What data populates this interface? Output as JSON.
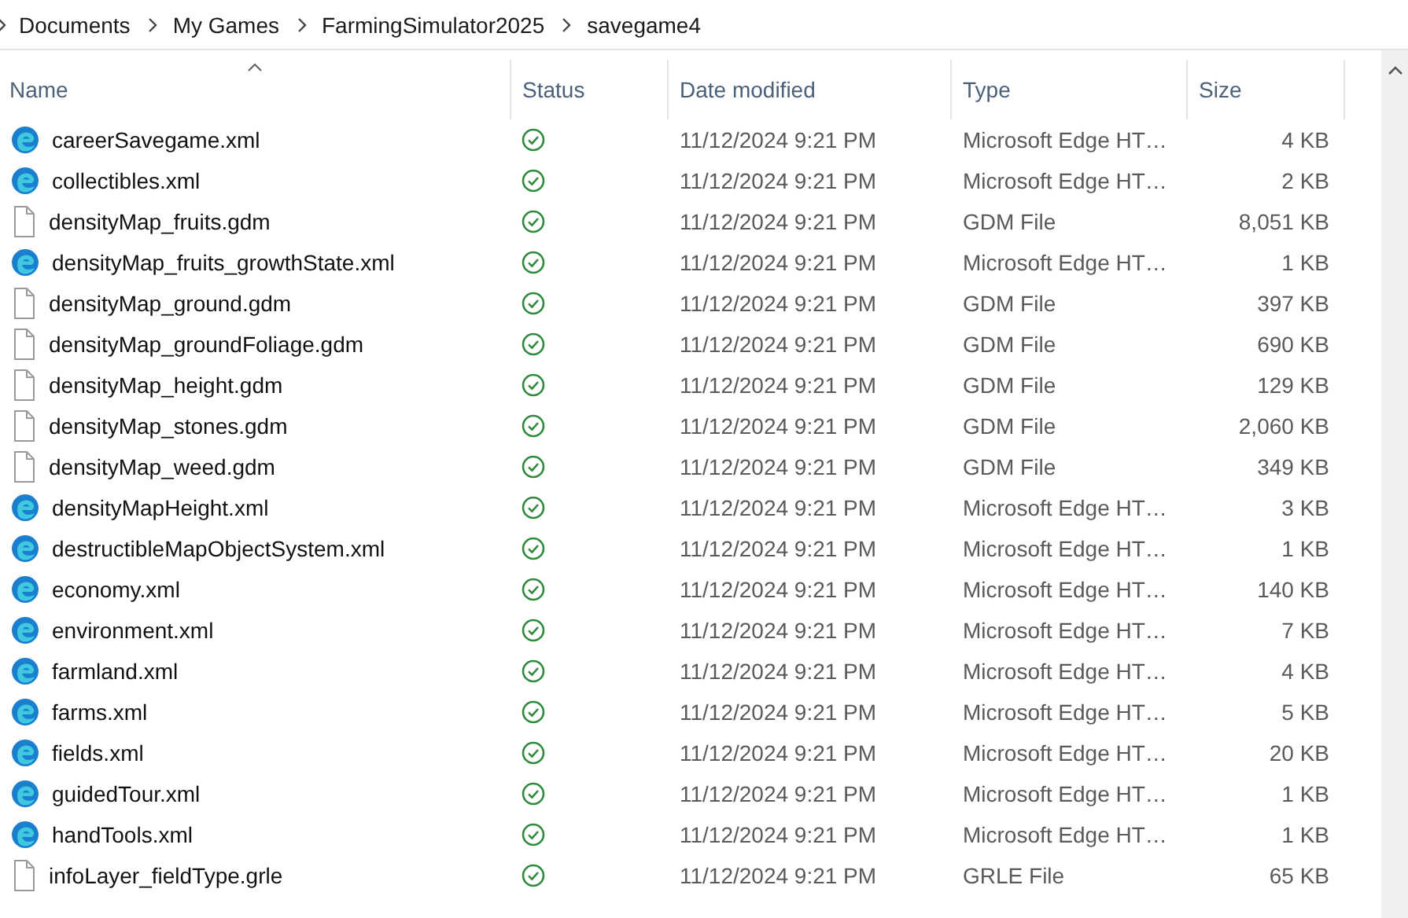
{
  "breadcrumb": [
    "Documents",
    "My Games",
    "FarmingSimulator2025",
    "savegame4"
  ],
  "columns": [
    {
      "label": "Name",
      "sorted": true
    },
    {
      "label": "Status",
      "sorted": false
    },
    {
      "label": "Date modified",
      "sorted": false
    },
    {
      "label": "Type",
      "sorted": false
    },
    {
      "label": "Size",
      "sorted": false
    }
  ],
  "rows": [
    {
      "kind": "edge",
      "name": "careerSavegame.xml",
      "date": "11/12/2024 9:21 PM",
      "type": "Microsoft Edge HT…",
      "size": "4 KB"
    },
    {
      "kind": "edge",
      "name": "collectibles.xml",
      "date": "11/12/2024 9:21 PM",
      "type": "Microsoft Edge HT…",
      "size": "2 KB"
    },
    {
      "kind": "file",
      "name": "densityMap_fruits.gdm",
      "date": "11/12/2024 9:21 PM",
      "type": "GDM File",
      "size": "8,051 KB"
    },
    {
      "kind": "edge",
      "name": "densityMap_fruits_growthState.xml",
      "date": "11/12/2024 9:21 PM",
      "type": "Microsoft Edge HT…",
      "size": "1 KB"
    },
    {
      "kind": "file",
      "name": "densityMap_ground.gdm",
      "date": "11/12/2024 9:21 PM",
      "type": "GDM File",
      "size": "397 KB"
    },
    {
      "kind": "file",
      "name": "densityMap_groundFoliage.gdm",
      "date": "11/12/2024 9:21 PM",
      "type": "GDM File",
      "size": "690 KB"
    },
    {
      "kind": "file",
      "name": "densityMap_height.gdm",
      "date": "11/12/2024 9:21 PM",
      "type": "GDM File",
      "size": "129 KB"
    },
    {
      "kind": "file",
      "name": "densityMap_stones.gdm",
      "date": "11/12/2024 9:21 PM",
      "type": "GDM File",
      "size": "2,060 KB"
    },
    {
      "kind": "file",
      "name": "densityMap_weed.gdm",
      "date": "11/12/2024 9:21 PM",
      "type": "GDM File",
      "size": "349 KB"
    },
    {
      "kind": "edge",
      "name": "densityMapHeight.xml",
      "date": "11/12/2024 9:21 PM",
      "type": "Microsoft Edge HT…",
      "size": "3 KB"
    },
    {
      "kind": "edge",
      "name": "destructibleMapObjectSystem.xml",
      "date": "11/12/2024 9:21 PM",
      "type": "Microsoft Edge HT…",
      "size": "1 KB"
    },
    {
      "kind": "edge",
      "name": "economy.xml",
      "date": "11/12/2024 9:21 PM",
      "type": "Microsoft Edge HT…",
      "size": "140 KB"
    },
    {
      "kind": "edge",
      "name": "environment.xml",
      "date": "11/12/2024 9:21 PM",
      "type": "Microsoft Edge HT…",
      "size": "7 KB"
    },
    {
      "kind": "edge",
      "name": "farmland.xml",
      "date": "11/12/2024 9:21 PM",
      "type": "Microsoft Edge HT…",
      "size": "4 KB"
    },
    {
      "kind": "edge",
      "name": "farms.xml",
      "date": "11/12/2024 9:21 PM",
      "type": "Microsoft Edge HT…",
      "size": "5 KB"
    },
    {
      "kind": "edge",
      "name": "fields.xml",
      "date": "11/12/2024 9:21 PM",
      "type": "Microsoft Edge HT…",
      "size": "20 KB"
    },
    {
      "kind": "edge",
      "name": "guidedTour.xml",
      "date": "11/12/2024 9:21 PM",
      "type": "Microsoft Edge HT…",
      "size": "1 KB"
    },
    {
      "kind": "edge",
      "name": "handTools.xml",
      "date": "11/12/2024 9:21 PM",
      "type": "Microsoft Edge HT…",
      "size": "1 KB"
    },
    {
      "kind": "file",
      "name": "infoLayer_fieldType.grle",
      "date": "11/12/2024 9:21 PM",
      "type": "GRLE File",
      "size": "65 KB"
    }
  ]
}
